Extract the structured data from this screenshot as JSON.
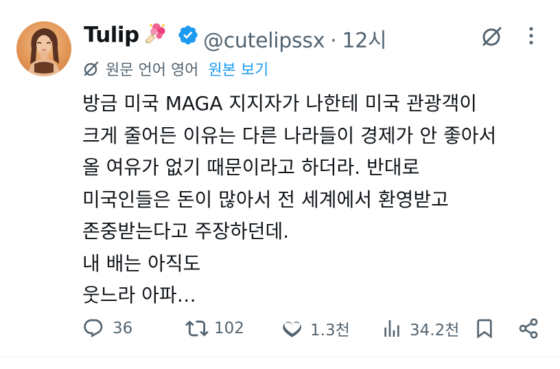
{
  "tweet": {
    "author_name": "Tulip",
    "handle": "@cutelipssx",
    "separator": "·",
    "time": "12시",
    "translate": {
      "label": "원문 언어 영어",
      "link": "원본 보기"
    },
    "lines": [
      "방금 미국 MAGA 지지자가 나한테 미국 관광객이",
      "크게 줄어든 이유는 다른 나라들이 경제가 안 좋아서",
      "올 여유가 없기 때문이라고 하더라. 반대로",
      "미국인들은 돈이 많아서 전 세계에서 환영받고",
      "존중받는다고 주장하던데.",
      "내 배는 아직도",
      "웃느라 아파…"
    ],
    "actions": {
      "replies": "36",
      "reposts": "102",
      "likes": "1.3천",
      "views": "34.2천"
    }
  },
  "icons": {
    "verified": "verified-badge-icon",
    "flower": "bouquet-emoji-icon",
    "grok": "grok-icon",
    "more": "more-vertical-icon",
    "reply": "reply-icon",
    "repost": "repost-icon",
    "like": "heart-icon",
    "views": "views-icon",
    "bookmark": "bookmark-icon",
    "share": "share-icon"
  },
  "colors": {
    "text": "#0f1419",
    "secondary": "#536471",
    "link": "#1d9bf0",
    "verified": "#1d9bf0"
  }
}
